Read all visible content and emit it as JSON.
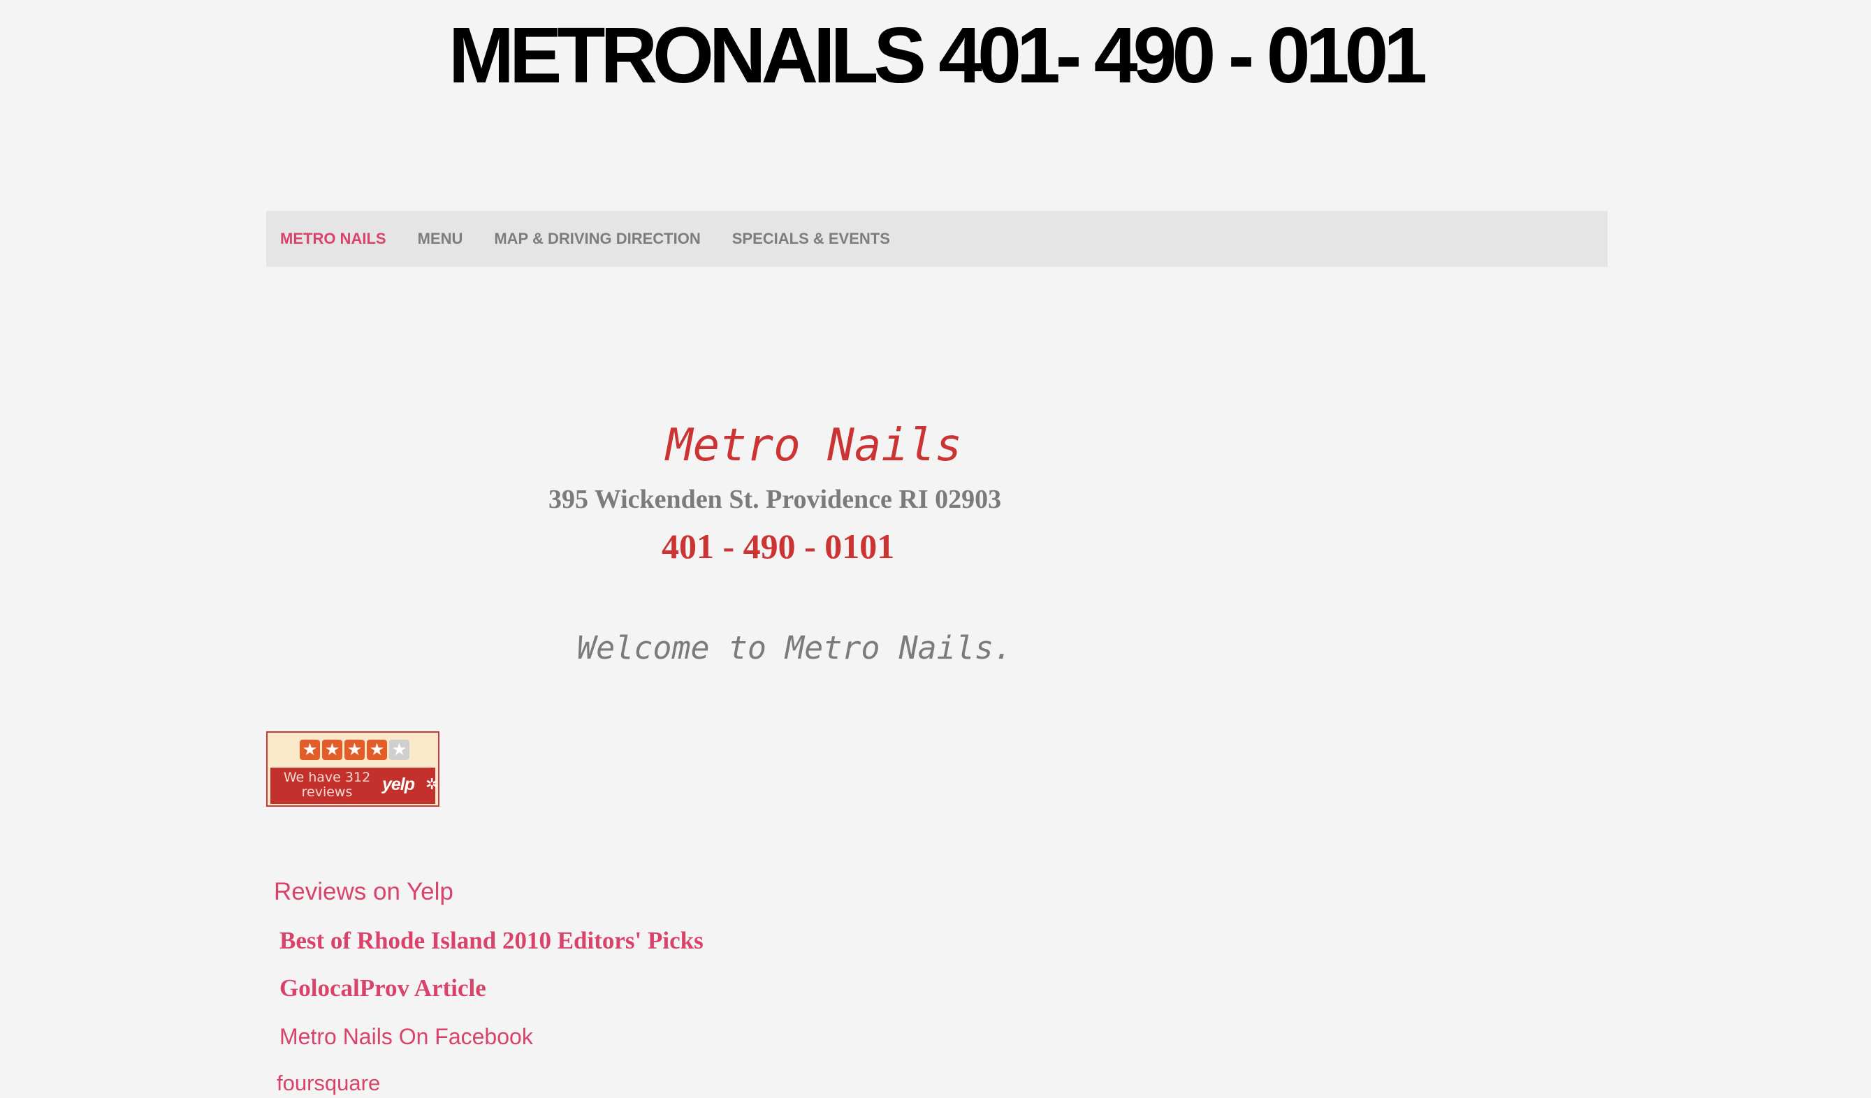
{
  "header": {
    "title": "METRONAILS 401- 490 - 0101"
  },
  "nav": {
    "items": [
      {
        "label": "METRO NAILS",
        "active": true
      },
      {
        "label": "MENU",
        "active": false
      },
      {
        "label": "MAP & DRIVING DIRECTION",
        "active": false
      },
      {
        "label": "SPECIALS & EVENTS",
        "active": false
      }
    ]
  },
  "main": {
    "store_name": "Metro Nails",
    "address": "395 Wickenden St. Providence RI 02903",
    "phone": "401 - 490 - 0101",
    "welcome": "Welcome to Metro Nails."
  },
  "yelp_badge": {
    "rating": 4,
    "max_rating": 5,
    "review_text": "We have 312 reviews",
    "logo_text": "yelp",
    "colors": {
      "star_on": "#e35d29",
      "star_off": "#cfcfcf",
      "bar": "#c4302b"
    }
  },
  "links": {
    "reviews": "Reviews on Yelp",
    "best_of": "Best of Rhode Island 2010 Editors' Picks",
    "golocal": "GolocalProv Article",
    "facebook": "Metro Nails On Facebook",
    "foursquare": "foursquare"
  },
  "colors": {
    "accent": "#d9436a",
    "brand_red": "#cc3333",
    "gray_text": "#7b7b7b",
    "background": "#f4f4f4",
    "nav_background": "#e5e5e5"
  }
}
